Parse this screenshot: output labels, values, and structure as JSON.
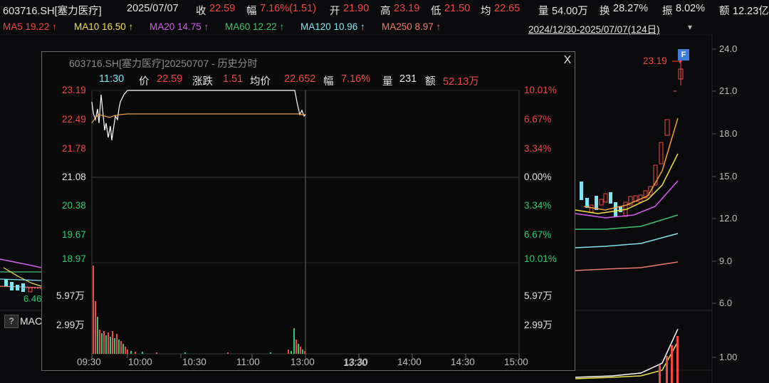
{
  "header": {
    "symbol": "603716.SH[塞力医疗]",
    "date": "2025/07/07",
    "close_label": "收",
    "close_value": "22.59",
    "change_label": "幅",
    "change_value": "7.16%(1.51)",
    "open_label": "开",
    "open_value": "21.90",
    "high_label": "高",
    "high_value": "23.19",
    "low_label": "低",
    "low_value": "21.50",
    "avg_label": "均",
    "avg_value": "22.65",
    "vol_label": "量",
    "vol_value": "54.00万",
    "turnover_label": "换",
    "turnover_value": "28.27%",
    "amp_label": "振",
    "amp_value": "8.02%",
    "amount_label": "额",
    "amount_value": "12.23亿"
  },
  "ma_bar": {
    "items": [
      {
        "label": "MA5 19.22 ↑",
        "color": "#f04747"
      },
      {
        "label": "MA10 16.50 ↑",
        "color": "#f2e14a"
      },
      {
        "label": "MA20 14.75 ↑",
        "color": "#d65cf0"
      },
      {
        "label": "MA60 12.22 ↑",
        "color": "#3fc46b"
      },
      {
        "label": "MA120 10.96 ↑",
        "color": "#7fe3f0"
      },
      {
        "label": "MA250 8.97 ↑",
        "color": "#f07a6a"
      }
    ],
    "range": "2024/12/30-2025/07/07(124日)",
    "range_dropdown": "chevron-down"
  },
  "right_axis": [
    "24.0",
    "21.0",
    "18.0",
    "15.0",
    "12.0",
    "9.0",
    "6.0",
    "1.00"
  ],
  "main_chart": {
    "high_marker": "23.19",
    "low_label": "6.46",
    "flag": "F",
    "indicator_label": "MAC",
    "help": "?"
  },
  "popup": {
    "title": "603716.SH[塞力医疗]20250707 - 历史分时",
    "close": "X",
    "info": {
      "time": "11:30",
      "price_label": "价",
      "price_value": "22.59",
      "chg_label": "涨跌",
      "chg_value": "1.51",
      "avg_label": "均价",
      "avg_value": "22.652",
      "pct_label": "幅",
      "pct_value": "7.16%",
      "vol_label": "量",
      "vol_value": "231",
      "amt_label": "额",
      "amt_value": "52.13万"
    },
    "price_labels": [
      "23.19",
      "22.49",
      "21.78",
      "21.08",
      "20.38",
      "19.67",
      "18.97"
    ],
    "pct_labels": [
      "10.01%",
      "6.67%",
      "3.34%",
      "0.00%",
      "3.34%",
      "6.67%",
      "10.01%"
    ],
    "vol_labels": [
      "5.97万",
      "2.99万"
    ],
    "time_labels": [
      "09:30",
      "10:00",
      "10:30",
      "11:00",
      "13:00",
      "13:30",
      "14:00",
      "14:30",
      "15:00"
    ]
  },
  "colors": {
    "up": "#f04747",
    "down": "#2ecc71",
    "flat": "#e6e6e6",
    "price_line": "#ffffff",
    "avg_line": "#f0a040"
  }
}
